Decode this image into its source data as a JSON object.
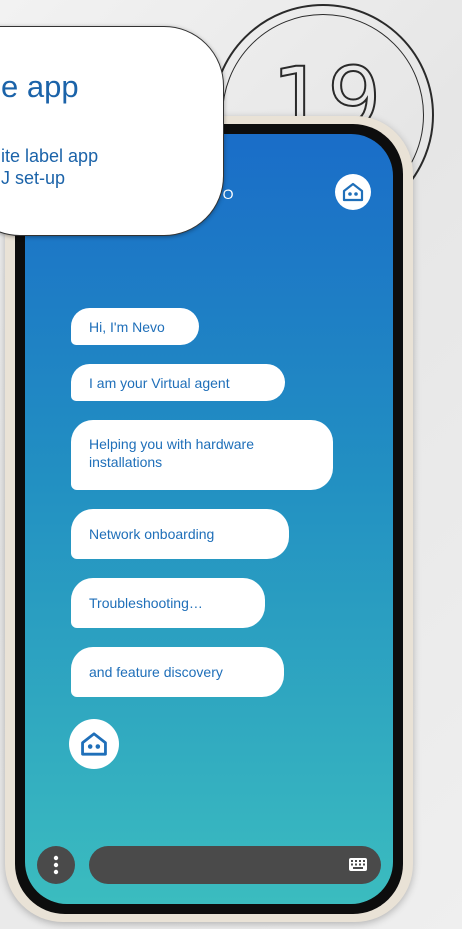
{
  "badge": {
    "number": "19"
  },
  "callout": {
    "title": "e app",
    "line1": "ite label app",
    "line2": "J set-up"
  },
  "screen": {
    "title": "EVO",
    "messages": [
      "Hi, I'm Nevo",
      "I am your Virtual agent",
      "Helping you with hardware installations",
      "Network onboarding",
      "Troubleshooting…",
      "and feature discovery"
    ]
  },
  "icons": {
    "header_avatar": "robot-face-icon",
    "agent_avatar": "robot-face-icon",
    "menu": "vertical-ellipsis-icon",
    "keyboard": "keyboard-icon"
  },
  "colors": {
    "gradient_top": "#1a6dc8",
    "gradient_bottom": "#3bbcbf",
    "bubble_text": "#1f6fb9",
    "callout_text": "#1b63a9",
    "input_bar": "#4a4a4a"
  }
}
